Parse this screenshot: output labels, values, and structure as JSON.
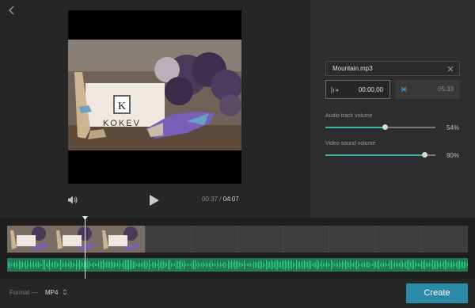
{
  "nav": {
    "back_icon": "chevron-left-icon"
  },
  "player": {
    "current_time": "00:37",
    "separator": "/",
    "total_time": "04:07",
    "progress_fraction": 0.15
  },
  "preview": {
    "brand_letter": "K",
    "brand_text": "KOKEV"
  },
  "audio": {
    "file_name": "Mountain.mp3",
    "trim_start": "00:00,00",
    "trim_end": "05:33",
    "track_volume_label": "Audio track volume",
    "track_volume_value": "54%",
    "track_volume_fraction": 0.54,
    "video_volume_label": "Video sound volume",
    "video_volume_value": "90%",
    "video_volume_fraction": 0.9
  },
  "footer": {
    "format_label": "Format —",
    "format_value": "MP4",
    "create_label": "Create"
  },
  "colors": {
    "accent": "#3cb5a0",
    "button": "#2a8aa8",
    "waveform": "#2ecc8a"
  }
}
